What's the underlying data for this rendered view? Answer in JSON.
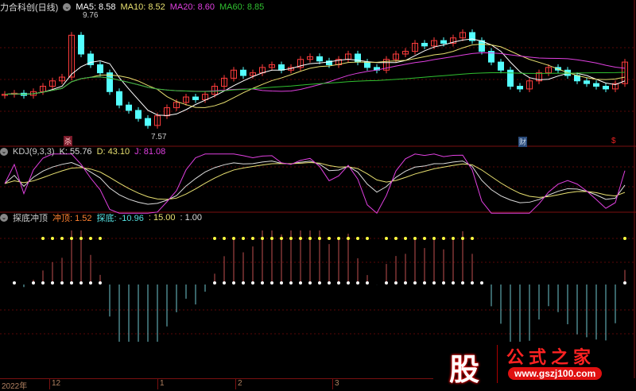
{
  "header": {
    "title": "力合科创(日线)",
    "ma5": "MA5: 8.58",
    "ma10": "MA10: 8.52",
    "ma20": "MA20: 8.60",
    "ma60": "MA60: 8.85",
    "high_label": "9.76",
    "low_label": "7.57",
    "marker_1": "杀",
    "marker_2": "财",
    "marker_3": "$"
  },
  "kdj": {
    "name": "KDJ(9,3,3)",
    "k": "K: 55.76",
    "d": "D: 43.10",
    "j": "J: 81.08"
  },
  "indicator": {
    "name": "探底冲顶",
    "top": "冲顶: 1.52",
    "bottom": "探底: -10.96",
    "v1": ": 15.00",
    "v2": ": 1.00"
  },
  "axis": {
    "labels": [
      "2022年",
      "12",
      "1",
      "2",
      "3"
    ]
  },
  "logo": {
    "char": "股",
    "text": "公式之家",
    "url": "www.gszj100.com"
  },
  "colors": {
    "up": "#ff3c3c",
    "down": "#54ffff",
    "ma5": "#ffffff",
    "ma10": "#e8e070",
    "ma20": "#e040e0",
    "ma60": "#30c030",
    "grid": "#7a1010"
  },
  "chart_data": {
    "type": "candlestick",
    "price_range": [
      7.57,
      9.76
    ],
    "open": [
      8.28,
      8.3,
      8.32,
      8.28,
      8.35,
      8.45,
      8.55,
      8.62,
      9.4,
      9.05,
      8.85,
      8.7,
      8.35,
      8.1,
      8.0,
      7.85,
      7.72,
      7.9,
      8.05,
      8.15,
      8.25,
      8.2,
      8.3,
      8.45,
      8.6,
      8.75,
      8.65,
      8.7,
      8.8,
      8.85,
      8.75,
      8.8,
      8.95,
      9.0,
      8.92,
      8.85,
      8.95,
      9.05,
      8.9,
      8.8,
      8.75,
      8.95,
      9.05,
      9.1,
      9.25,
      9.2,
      9.3,
      9.25,
      9.35,
      9.45,
      9.3,
      9.1,
      8.9,
      8.75,
      8.45,
      8.4,
      8.55,
      8.7,
      8.8,
      8.75,
      8.65,
      8.55,
      8.5,
      8.45,
      8.4,
      8.5
    ],
    "close": [
      8.3,
      8.32,
      8.28,
      8.35,
      8.45,
      8.55,
      8.62,
      9.4,
      9.05,
      8.85,
      8.7,
      8.35,
      8.1,
      8.0,
      7.85,
      7.72,
      7.9,
      8.05,
      8.15,
      8.25,
      8.2,
      8.3,
      8.45,
      8.6,
      8.75,
      8.65,
      8.7,
      8.8,
      8.85,
      8.75,
      8.8,
      8.95,
      9.0,
      8.92,
      8.85,
      8.95,
      9.05,
      8.9,
      8.8,
      8.75,
      8.95,
      9.05,
      9.1,
      9.25,
      9.2,
      9.3,
      9.25,
      9.35,
      9.45,
      9.3,
      9.1,
      8.9,
      8.75,
      8.45,
      8.4,
      8.55,
      8.7,
      8.8,
      8.75,
      8.65,
      8.55,
      8.5,
      8.45,
      8.4,
      8.5,
      8.9
    ]
  }
}
